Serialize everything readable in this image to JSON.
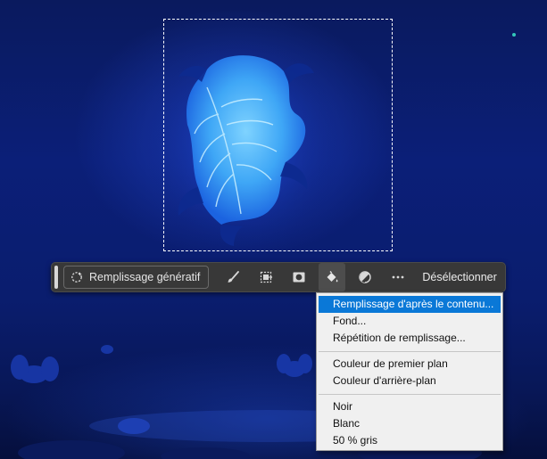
{
  "canvas": {
    "subject": "leaf-in-cave-artwork"
  },
  "taskbar": {
    "generative_fill_label": "Remplissage génératif",
    "tools": [
      {
        "icon": "brush-icon"
      },
      {
        "icon": "transform-selection-icon"
      },
      {
        "icon": "mask-icon"
      },
      {
        "icon": "paint-bucket-icon",
        "active": true
      },
      {
        "icon": "adjustment-icon"
      },
      {
        "icon": "more-icon"
      }
    ],
    "deselect_label": "Désélectionner"
  },
  "fill_menu": {
    "group1": [
      "Remplissage d'après le contenu...",
      "Fond...",
      "Répétition de remplissage..."
    ],
    "group2": [
      "Couleur de premier plan",
      "Couleur d'arrière-plan"
    ],
    "group3": [
      "Noir",
      "Blanc",
      "50 % gris"
    ],
    "highlighted": "Remplissage d'après le contenu..."
  },
  "colors": {
    "taskbar_bg": "#383838",
    "menu_highlight": "#0a78d7",
    "menu_bg": "#f0f0f0"
  }
}
